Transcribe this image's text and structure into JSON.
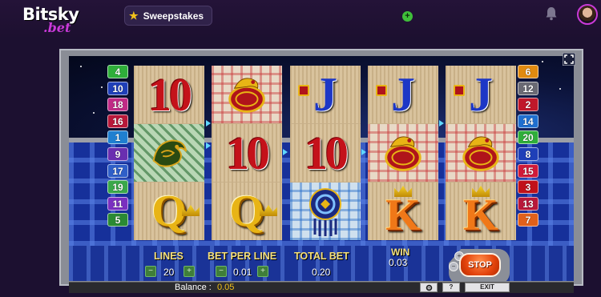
{
  "header": {
    "logo_main": "Bitsky",
    "logo_sub": ".bet",
    "sweepstakes_label": "Sweepstakes",
    "plus_symbol": "+",
    "icons": [
      "star-icon",
      "plus-icon",
      "bell-icon",
      "avatar"
    ]
  },
  "game": {
    "paylines_left": [
      {
        "label": "4",
        "color": "#2fae3a"
      },
      {
        "label": "10",
        "color": "#1f3fb8"
      },
      {
        "label": "18",
        "color": "#c02a86"
      },
      {
        "label": "16",
        "color": "#b8183a"
      },
      {
        "label": "1",
        "color": "#1f7fd0"
      },
      {
        "label": "9",
        "color": "#6a2fb0"
      },
      {
        "label": "17",
        "color": "#2f5fc8"
      },
      {
        "label": "19",
        "color": "#3aa84a"
      },
      {
        "label": "11",
        "color": "#7a2fc0"
      },
      {
        "label": "5",
        "color": "#2a8a34"
      }
    ],
    "paylines_right": [
      {
        "label": "6",
        "color": "#e08a10"
      },
      {
        "label": "12",
        "color": "#6a6a74"
      },
      {
        "label": "2",
        "color": "#c0182a"
      },
      {
        "label": "14",
        "color": "#1f6fd0"
      },
      {
        "label": "20",
        "color": "#2fae3a"
      },
      {
        "label": "8",
        "color": "#1f3fb8"
      },
      {
        "label": "15",
        "color": "#d01a3a"
      },
      {
        "label": "3",
        "color": "#c0121a"
      },
      {
        "label": "13",
        "color": "#b8183a"
      },
      {
        "label": "7",
        "color": "#e0601a"
      }
    ],
    "reels": [
      {
        "symbols": [
          "10",
          "jade-mask",
          "Q"
        ]
      },
      {
        "symbols": [
          "golden-snake",
          "10",
          "Q"
        ]
      },
      {
        "symbols": [
          "J",
          "10",
          "sun-shield"
        ]
      },
      {
        "symbols": [
          "J",
          "golden-snake",
          "K"
        ]
      },
      {
        "symbols": [
          "J",
          "golden-snake",
          "K"
        ]
      }
    ],
    "controls": {
      "lines_label": "LINES",
      "lines_value": "20",
      "bet_per_line_label": "BET PER LINE",
      "bet_per_line_value": "0.01",
      "total_bet_label": "TOTAL BET",
      "total_bet_value": "0.20",
      "win_label": "WIN",
      "win_value": "0.03",
      "stop_label": "STOP",
      "minus_symbol": "−",
      "plus_symbol": "+"
    },
    "status_bar": {
      "balance_label": "Balance :",
      "balance_value": "0.05",
      "help_label": "?",
      "exit_label": "EXIT"
    },
    "colors": {
      "ten": "#c4121a",
      "jack": "#1d37c6",
      "queen": "#e8b415",
      "king": "#f07818",
      "stop": "#e3430c"
    }
  }
}
